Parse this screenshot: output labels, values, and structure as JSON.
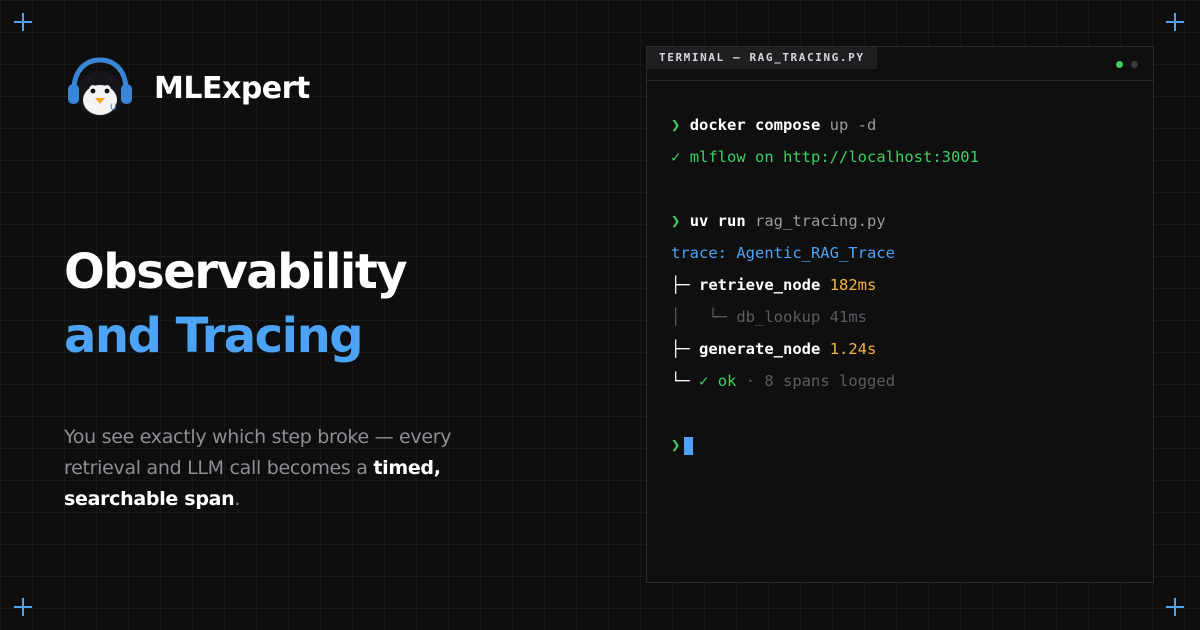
{
  "brand": {
    "name": "MLExpert",
    "logo_icon": "penguin-headphones-icon"
  },
  "headline": {
    "line1": "Observability",
    "line2": "and Tracing"
  },
  "description": {
    "part1": "You see exactly which step broke — every retrieval and LLM call becomes a ",
    "emphasis": "timed, searchable span",
    "part2": "."
  },
  "terminal": {
    "tab_title": "TERMINAL — RAG_TRACING.PY",
    "prompt_symbol": "❯",
    "check_symbol": "✓",
    "cmd1": {
      "bold": "docker compose",
      "rest": " up -d"
    },
    "out1": {
      "text": "mlflow on http://localhost:3001"
    },
    "cmd2": {
      "bold": "uv run",
      "rest": " rag_tracing.py"
    },
    "trace_line": "trace: Agentic_RAG_Trace",
    "node1": {
      "branch": "├─",
      "name": "retrieve_node",
      "time": "182ms"
    },
    "child1": {
      "branch": "│   └─",
      "text": "db_lookup 41ms"
    },
    "node2": {
      "branch": "├─",
      "name": "generate_node",
      "time": "1.24s"
    },
    "final": {
      "branch": "└─",
      "status": "ok",
      "detail": "· 8 spans logged"
    }
  },
  "colors": {
    "accent": "#4da3f5",
    "success": "#3fcf63",
    "warning": "#f5b440"
  }
}
